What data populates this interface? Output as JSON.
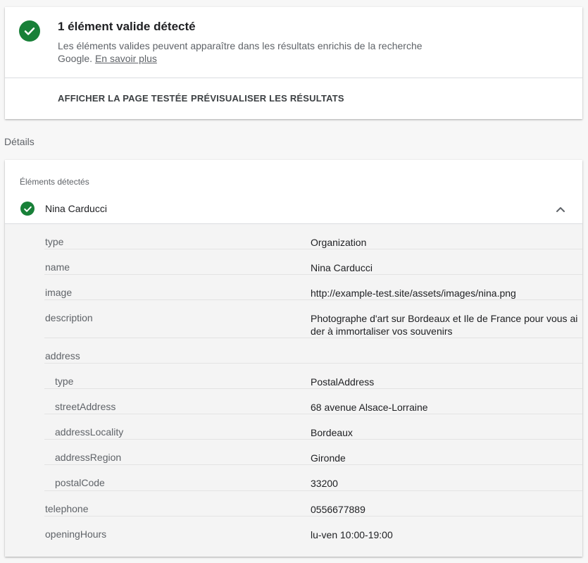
{
  "result": {
    "title": "1 élément valide détecté",
    "description": "Les éléments valides peuvent apparaître dans les résultats enrichis de la recherche Google.",
    "learn_more": "En savoir plus",
    "status_icon": "check-circle-icon",
    "status_color": "#188038"
  },
  "actions": {
    "view_tested_page": "AFFICHER LA PAGE TESTÉE",
    "preview_results": "PRÉVISUALISER LES RÉSULTATS"
  },
  "details": {
    "label": "Détails",
    "detected_label": "Éléments détectés",
    "item": {
      "name": "Nina Carducci",
      "expanded": true,
      "toggle_icon": "chevron-up-icon"
    },
    "properties": [
      {
        "key": "type",
        "value": "Organization",
        "indent": 0
      },
      {
        "key": "name",
        "value": "Nina Carducci",
        "indent": 0
      },
      {
        "key": "image",
        "value": "http://example-test.site/assets/images/nina.png",
        "indent": 0
      },
      {
        "key": "description",
        "value": "Photographe d'art sur Bordeaux et Ile de France pour vous ai der à immortaliser vos souvenirs",
        "indent": 0
      },
      {
        "key": "address",
        "value": "",
        "indent": 0
      },
      {
        "key": "type",
        "value": "PostalAddress",
        "indent": 1
      },
      {
        "key": "streetAddress",
        "value": "68 avenue Alsace-Lorraine",
        "indent": 1
      },
      {
        "key": "addressLocality",
        "value": "Bordeaux",
        "indent": 1
      },
      {
        "key": "addressRegion",
        "value": "Gironde",
        "indent": 1
      },
      {
        "key": "postalCode",
        "value": "33200",
        "indent": 1
      },
      {
        "key": "telephone",
        "value": "0556677889",
        "indent": 0
      },
      {
        "key": "openingHours",
        "value": "lu-ven 10:00-19:00",
        "indent": 0
      }
    ]
  }
}
